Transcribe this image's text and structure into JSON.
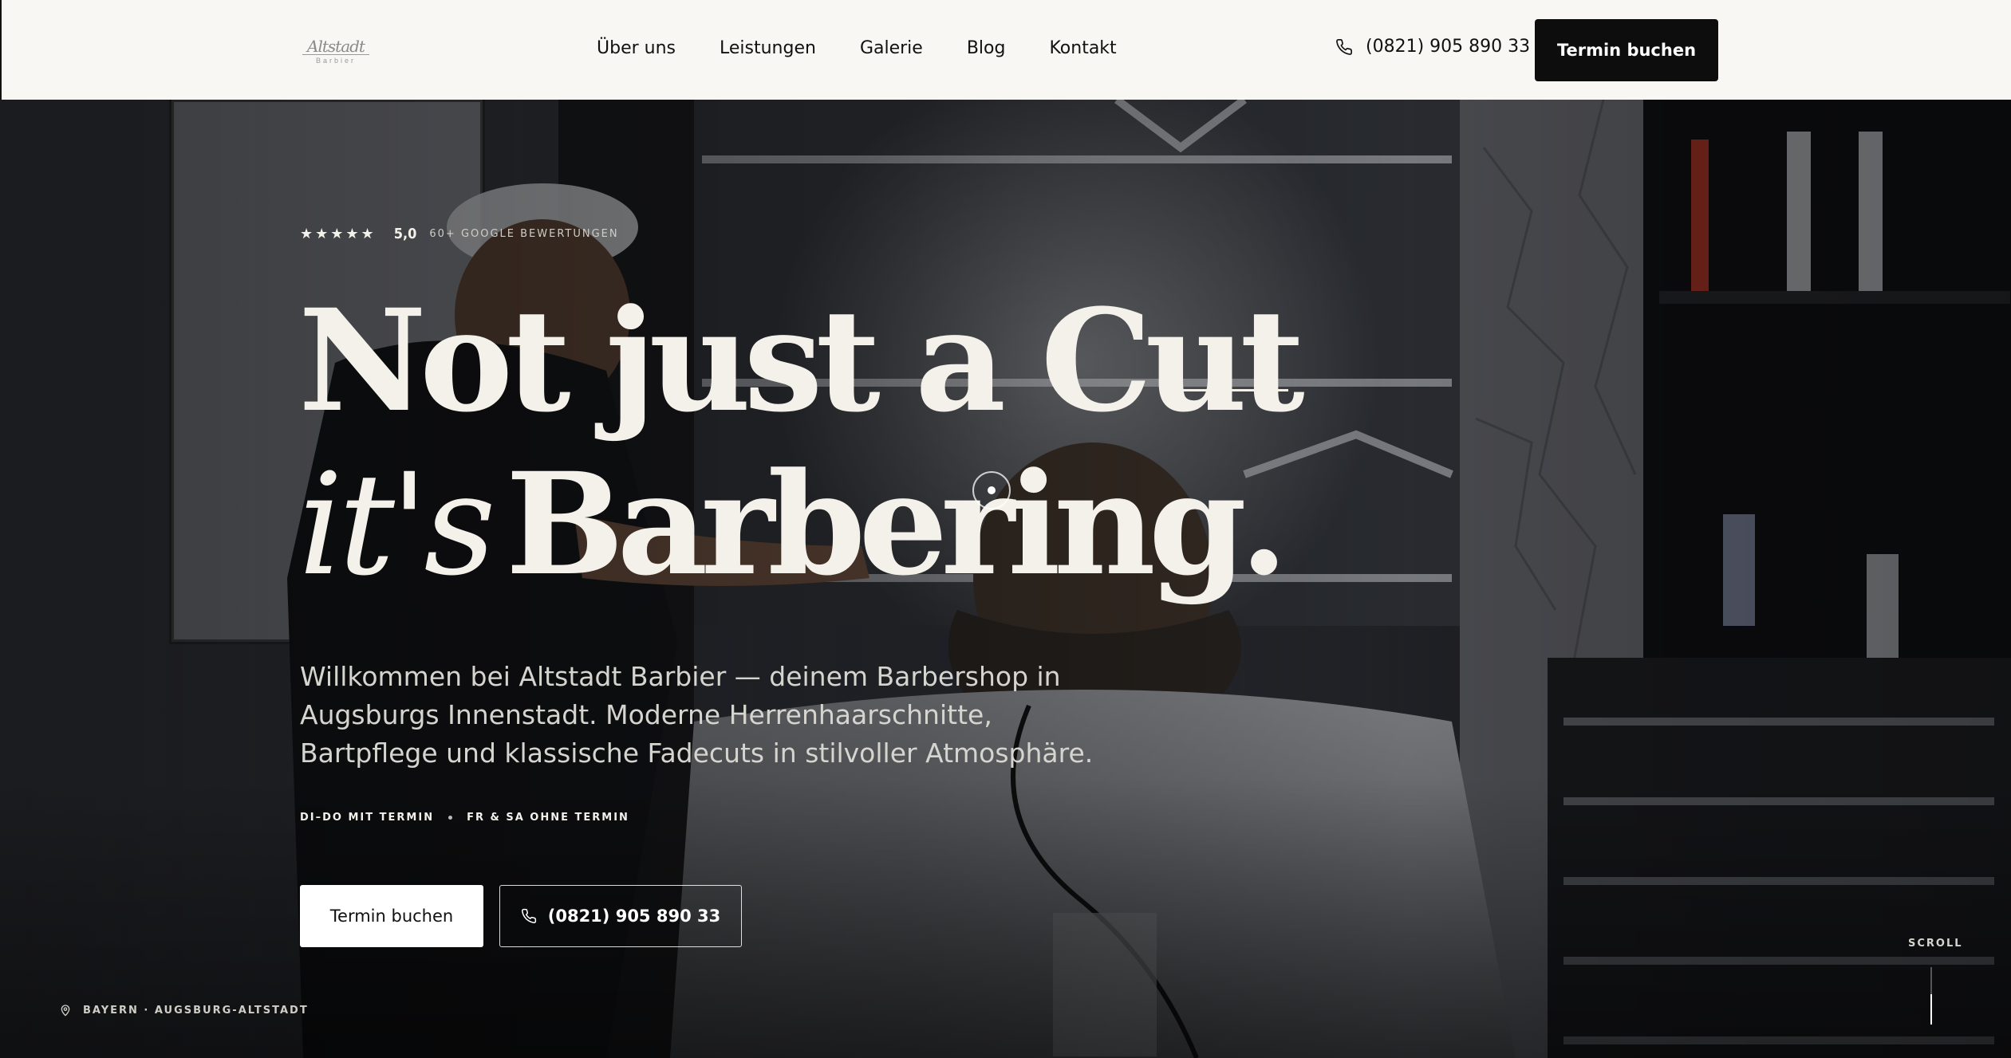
{
  "header": {
    "logo_script": "Altstadt",
    "logo_sub": "Barbier",
    "nav": [
      "Über uns",
      "Leistungen",
      "Galerie",
      "Blog",
      "Kontakt"
    ],
    "phone": "(0821) 905 890 33",
    "cta": "Termin buchen"
  },
  "hero": {
    "rating": {
      "stars": "★★★★★",
      "score": "5,0",
      "text": "60+ GOOGLE BEWERTUNGEN"
    },
    "headline": {
      "line1": "Not just a Cut",
      "line2_italic": "it's",
      "line2": "Barbering."
    },
    "intro": "Willkommen bei Altstadt Barbier — deinem Barbershop in Augsburgs Innenstadt. Moderne Herrenhaarschnitte, Bartpflege und klassische Fadecuts in stilvoller Atmosphäre.",
    "hours": {
      "left": "DI–DO MIT TERMIN",
      "right": "FR & SA OHNE TERMIN"
    },
    "primary_button": "Termin buchen",
    "secondary_button": "(0821) 905 890 33",
    "location": "BAYERN · AUGSBURG-ALTSTADT",
    "scroll": "SCROLL"
  },
  "icons": {
    "phone": "phone-icon",
    "location": "location-pin-icon",
    "star": "star-icon"
  },
  "colors": {
    "header_bg": "#f8f7f4",
    "cta_bg": "#0d0d0d",
    "headline": "#f4f1ea"
  }
}
